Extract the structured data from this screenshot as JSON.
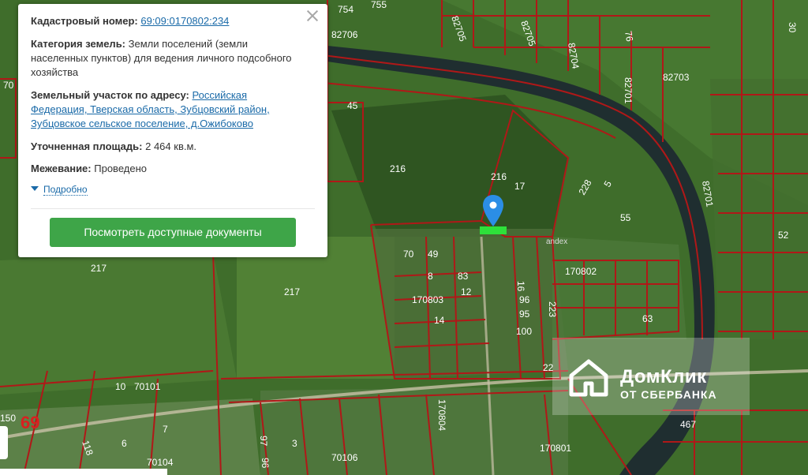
{
  "popup": {
    "cadastral_label": "Кадастровый номер:",
    "cadastral_value": "69:09:0170802:234",
    "category_label": "Категория земель:",
    "category_value": "Земли поселений (земли населенных пунктов) для ведения личного подсобного хозяйства",
    "address_label": "Земельный участок по адресу:",
    "address_value": "Российская Федерация, Тверская область, Зубцовский район, Зубцовское сельское поселение, д.Ожибоково",
    "area_label": "Уточненная площадь:",
    "area_value": "2 464 кв.м.",
    "survey_label": "Межевание:",
    "survey_value": "Проведено",
    "more_link": "Подробно",
    "docs_button": "Посмотреть доступные документы"
  },
  "watermark": {
    "brand": "ДомКлик",
    "sub": "ОТ СБЕРБАНКА"
  },
  "map": {
    "attribution": "andex",
    "colors": {
      "parcel": "#b01818",
      "river": "#1f2e30",
      "selected": "#2ee03a",
      "marker": "#2b8ee6"
    },
    "labels": [
      "754",
      "755",
      "82706",
      "82705",
      "82705",
      "82704",
      "76",
      "82703",
      "30",
      "70",
      "45",
      "216",
      "216",
      "17",
      "228",
      "5",
      "55",
      "82701",
      "82701",
      "52",
      "217",
      "217",
      "70",
      "49",
      "8",
      "83",
      "12",
      "170803",
      "16",
      "14",
      "96",
      "95",
      "100",
      "170802",
      "223",
      "63",
      "22",
      "10",
      "70101",
      "69",
      "7",
      "6",
      "70104",
      "97",
      "96",
      "3",
      "70106",
      "170804",
      "170801",
      "467",
      "150",
      "118"
    ]
  }
}
